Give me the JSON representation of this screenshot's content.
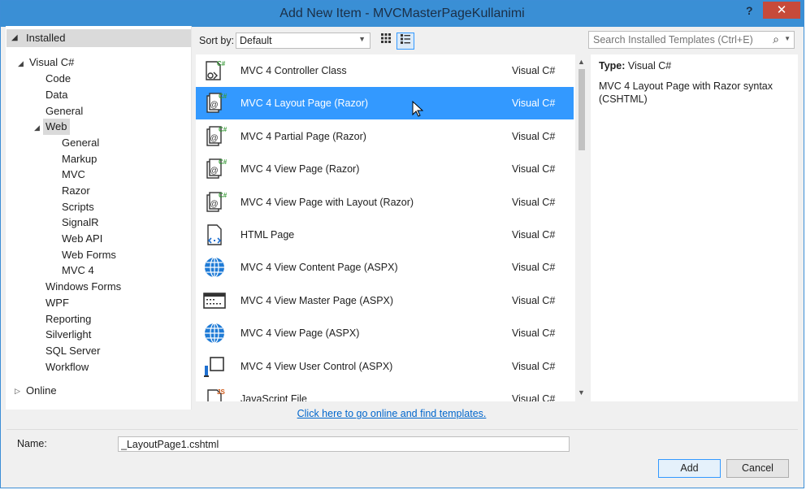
{
  "window": {
    "title": "Add New Item - MVCMasterPageKullanimi",
    "help": "?",
    "close": "✕"
  },
  "left_panel": {
    "installed_label": "Installed",
    "tree": [
      {
        "label": "Visual C#"
      },
      {
        "label": "Code"
      },
      {
        "label": "Data"
      },
      {
        "label": "General"
      },
      {
        "label": "Web"
      },
      {
        "label": "General"
      },
      {
        "label": "Markup"
      },
      {
        "label": "MVC"
      },
      {
        "label": "Razor"
      },
      {
        "label": "Scripts"
      },
      {
        "label": "SignalR"
      },
      {
        "label": "Web API"
      },
      {
        "label": "Web Forms"
      },
      {
        "label": "MVC 4"
      },
      {
        "label": "Windows Forms"
      },
      {
        "label": "WPF"
      },
      {
        "label": "Reporting"
      },
      {
        "label": "Silverlight"
      },
      {
        "label": "SQL Server"
      },
      {
        "label": "Workflow"
      }
    ],
    "online_label": "Online"
  },
  "toolbar": {
    "sort_label": "Sort by:",
    "sort_value": "Default",
    "search_placeholder": "Search Installed Templates (Ctrl+E)"
  },
  "templates": [
    {
      "name": "MVC 4 Controller Class",
      "lang": "Visual C#",
      "icon": "controller-class-icon"
    },
    {
      "name": "MVC 4 Layout Page (Razor)",
      "lang": "Visual C#",
      "icon": "razor-page-icon",
      "selected": true
    },
    {
      "name": "MVC 4 Partial Page (Razor)",
      "lang": "Visual C#",
      "icon": "razor-page-icon"
    },
    {
      "name": "MVC 4 View Page (Razor)",
      "lang": "Visual C#",
      "icon": "razor-page-icon"
    },
    {
      "name": "MVC 4 View Page with Layout (Razor)",
      "lang": "Visual C#",
      "icon": "razor-page-icon"
    },
    {
      "name": "HTML Page",
      "lang": "Visual C#",
      "icon": "html-page-icon"
    },
    {
      "name": "MVC 4 View Content Page (ASPX)",
      "lang": "Visual C#",
      "icon": "globe-icon"
    },
    {
      "name": "MVC 4 View Master Page (ASPX)",
      "lang": "Visual C#",
      "icon": "master-page-icon"
    },
    {
      "name": "MVC 4 View Page (ASPX)",
      "lang": "Visual C#",
      "icon": "globe-icon"
    },
    {
      "name": "MVC 4 View User Control (ASPX)",
      "lang": "Visual C#",
      "icon": "user-control-icon"
    },
    {
      "name": "JavaScript File",
      "lang": "Visual C#",
      "icon": "javascript-file-icon"
    }
  ],
  "details": {
    "type_label": "Type:",
    "type_value": "Visual C#",
    "description": "MVC 4 Layout Page with Razor syntax (CSHTML)"
  },
  "online_link": "Click here to go online and find templates.",
  "name_field": {
    "label": "Name:",
    "value": "_LayoutPage1.cshtml"
  },
  "buttons": {
    "add": "Add",
    "cancel": "Cancel"
  },
  "colors": {
    "titlebar": "#3a8fd5",
    "selection": "#3399ff",
    "close": "#c74a3a"
  }
}
